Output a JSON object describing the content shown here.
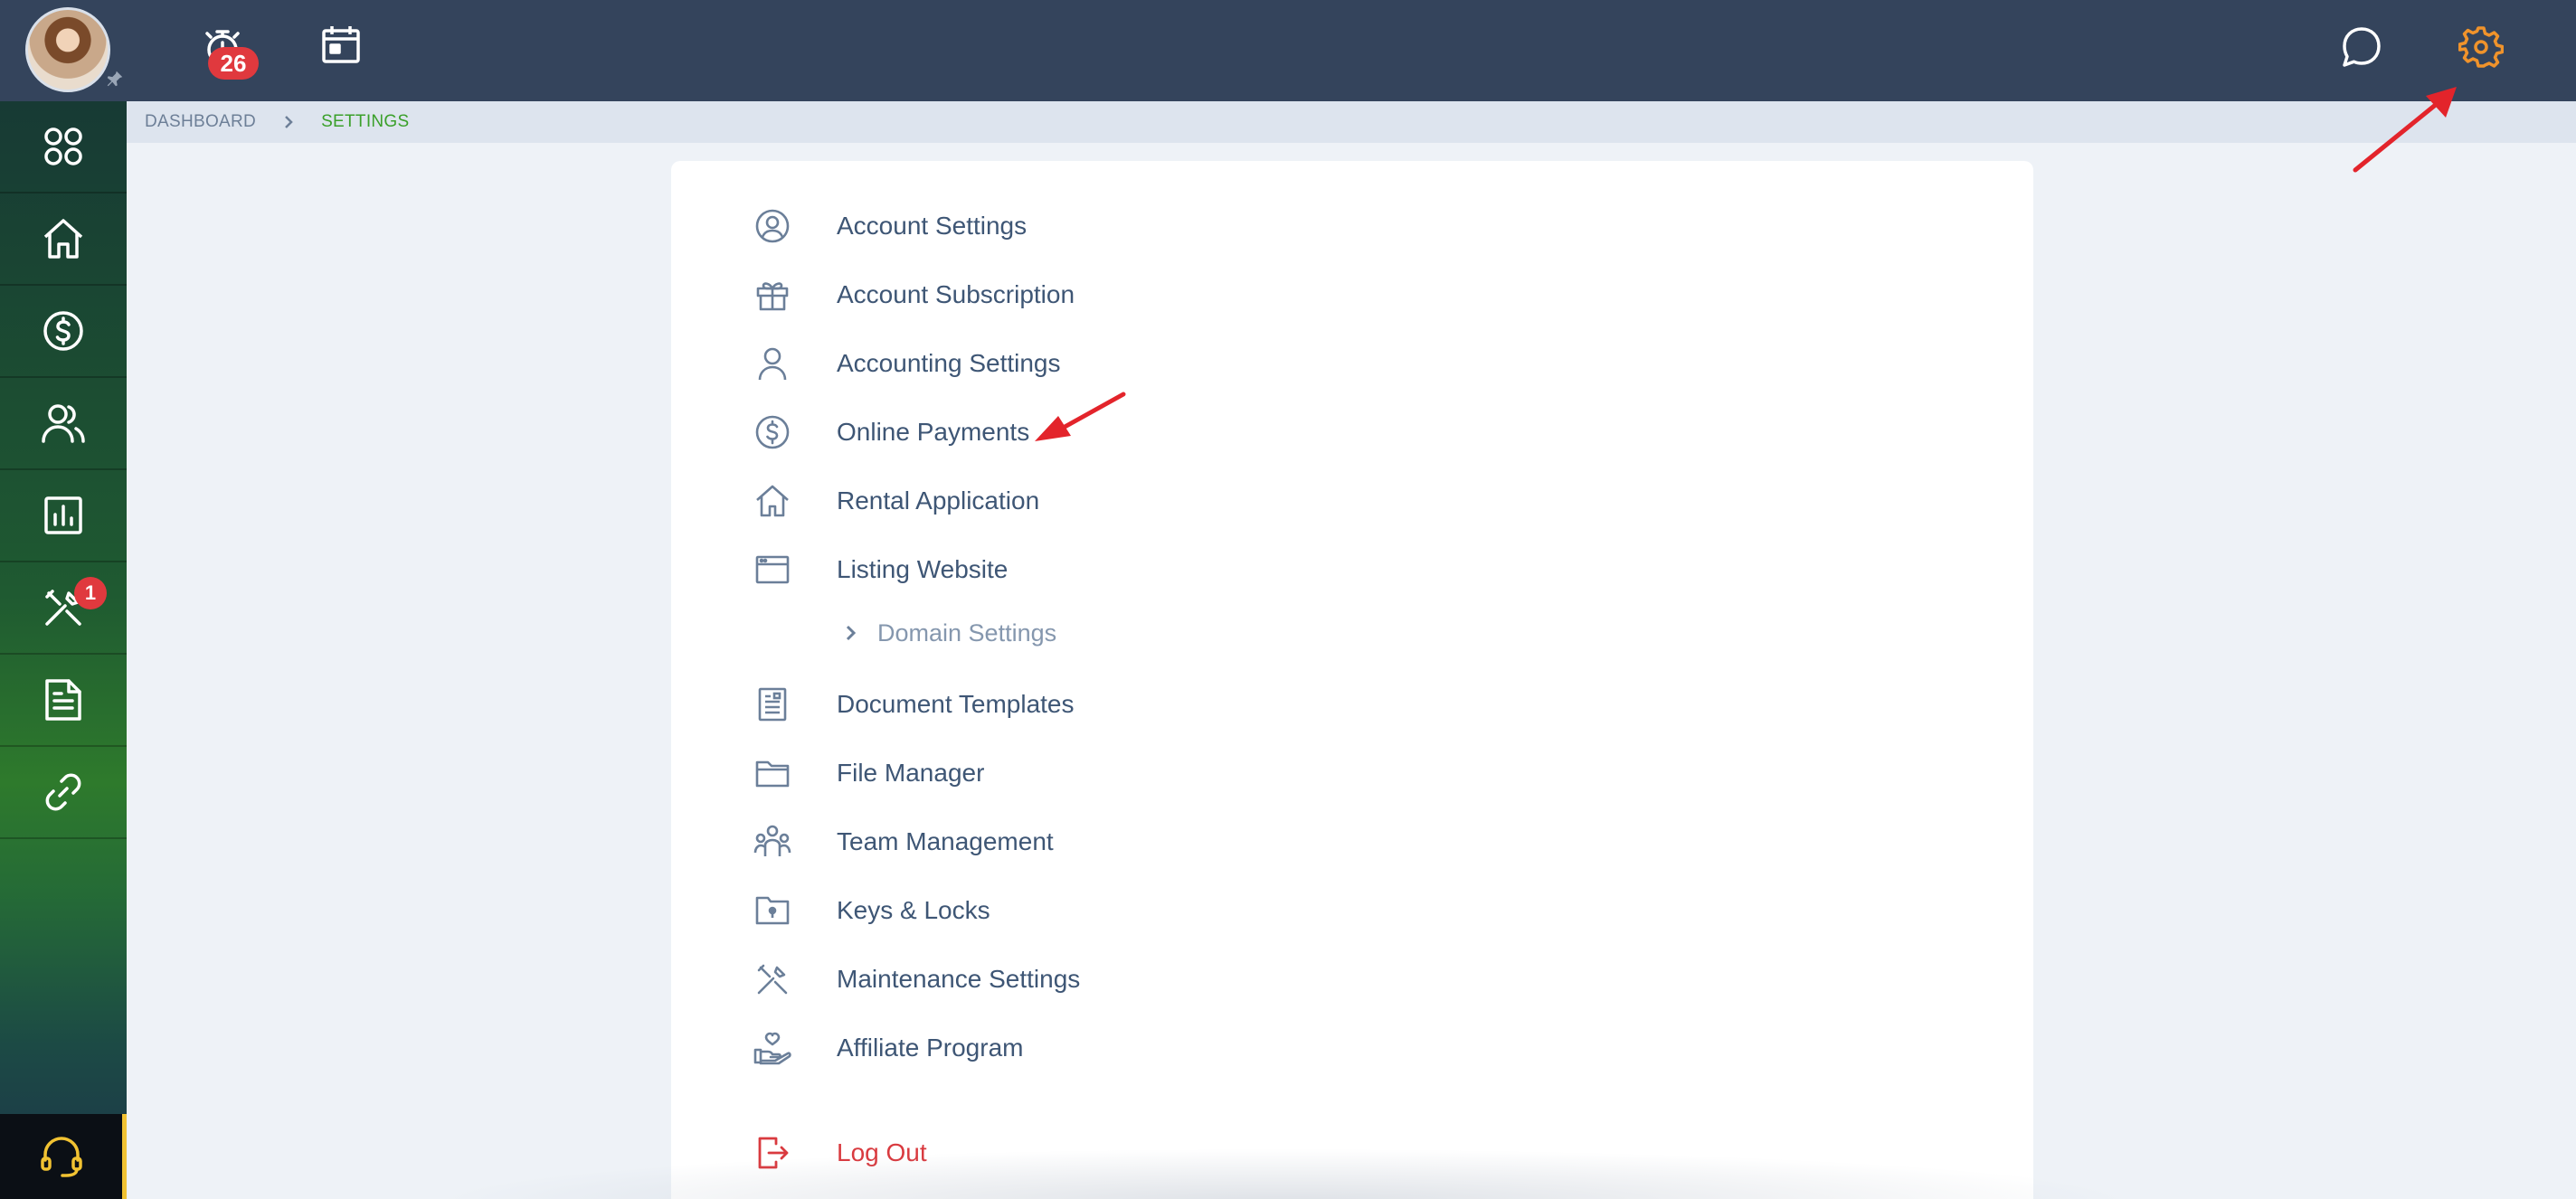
{
  "topbar": {
    "timer_badge": "26",
    "icons": {
      "timer": "stopwatch-icon",
      "calendar": "calendar-icon",
      "chat": "chat-bubble-icon",
      "settings": "gear-icon",
      "pin": "pin-icon"
    },
    "settings_color": "#f0932b"
  },
  "sidebar": {
    "items": [
      {
        "name": "apps",
        "icon": "apps-grid-icon"
      },
      {
        "name": "home",
        "icon": "home-icon"
      },
      {
        "name": "payments",
        "icon": "dollar-circle-icon"
      },
      {
        "name": "people",
        "icon": "people-icon"
      },
      {
        "name": "reports",
        "icon": "bar-chart-icon"
      },
      {
        "name": "maintenance",
        "icon": "tools-icon",
        "badge": "1"
      },
      {
        "name": "documents",
        "icon": "document-icon"
      },
      {
        "name": "links",
        "icon": "link-icon"
      }
    ],
    "support_icon": "headset-icon",
    "support_accent": "#f1c232"
  },
  "breadcrumb": {
    "dashboard": "DASHBOARD",
    "current": "SETTINGS"
  },
  "settings_menu": {
    "items": [
      {
        "label": "Account Settings",
        "icon": "user-circle-icon"
      },
      {
        "label": "Account Subscription",
        "icon": "gift-icon"
      },
      {
        "label": "Accounting Settings",
        "icon": "user-icon"
      },
      {
        "label": "Online Payments",
        "icon": "dollar-circle-icon"
      },
      {
        "label": "Rental Application",
        "icon": "house-icon"
      },
      {
        "label": "Listing Website",
        "icon": "browser-window-icon"
      },
      {
        "label": "Domain Settings",
        "icon": "chevron-right-icon"
      },
      {
        "label": "Document Templates",
        "icon": "document-list-icon"
      },
      {
        "label": "File Manager",
        "icon": "folder-icon"
      },
      {
        "label": "Team Management",
        "icon": "team-icon"
      },
      {
        "label": "Keys & Locks",
        "icon": "key-folder-icon"
      },
      {
        "label": "Maintenance Settings",
        "icon": "tools-icon"
      },
      {
        "label": "Affiliate Program",
        "icon": "hand-heart-icon"
      }
    ],
    "logout": {
      "label": "Log Out",
      "icon": "logout-icon",
      "color": "#d93a3f"
    }
  },
  "annotations": {
    "arrow_color": "#e3242b"
  }
}
